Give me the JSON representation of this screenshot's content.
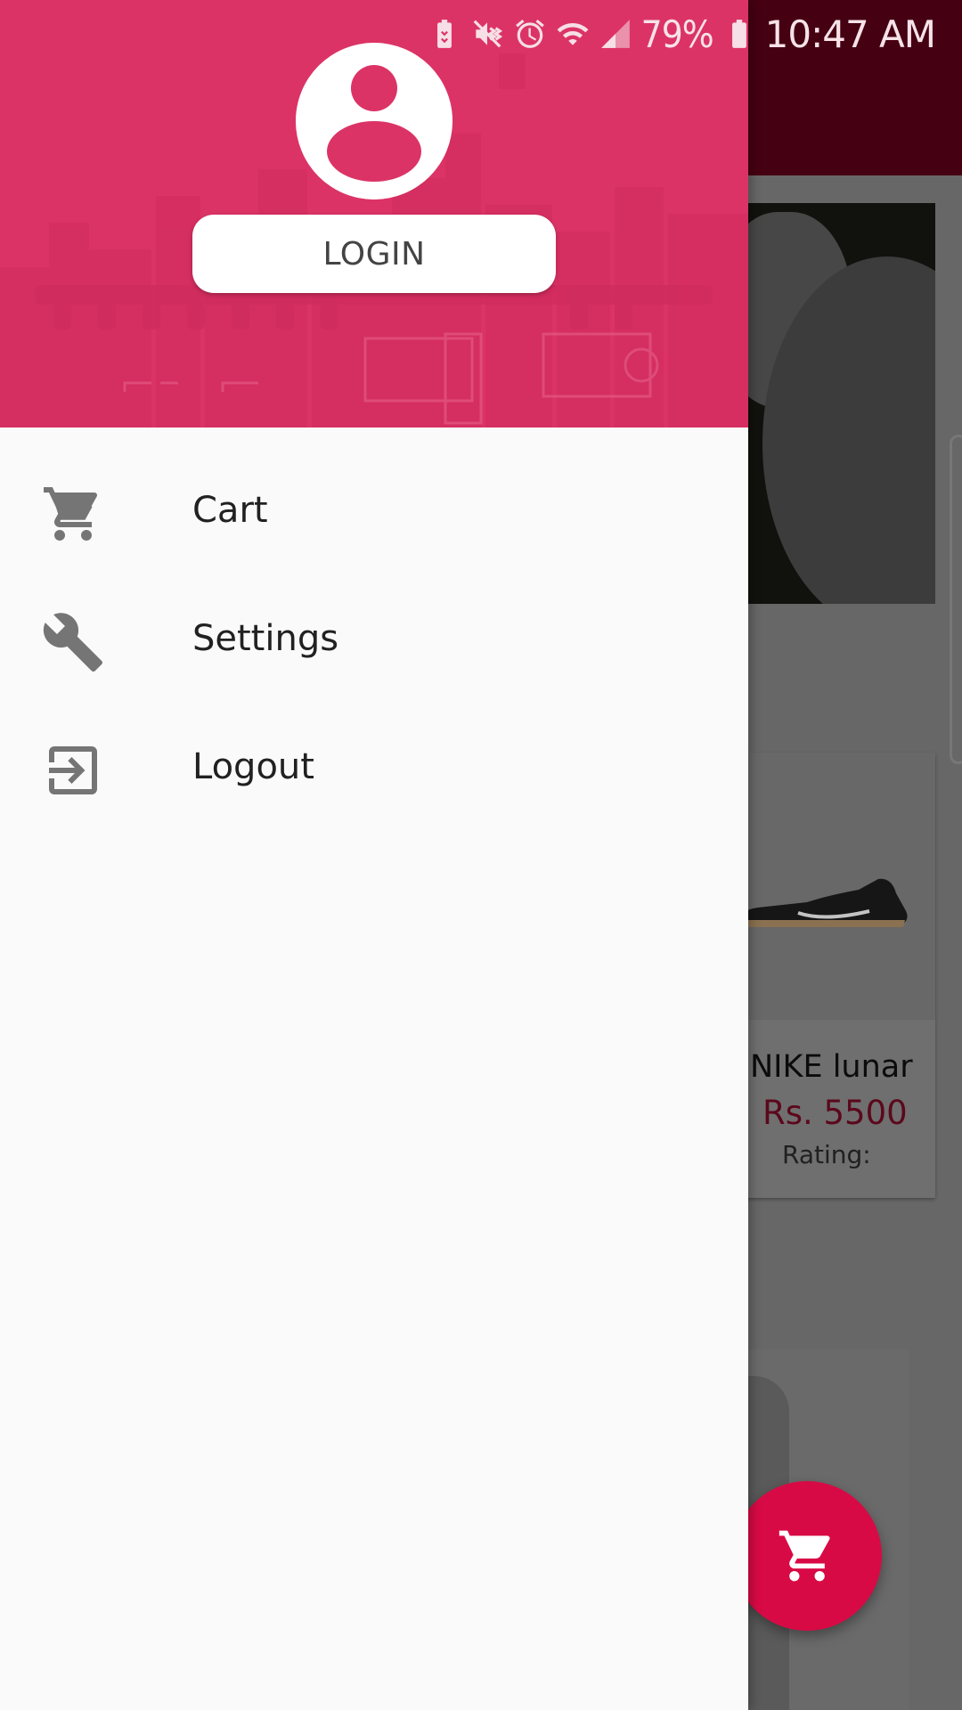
{
  "status_bar": {
    "battery_percent": "79%",
    "time": "10:47 AM",
    "icons": [
      "battery-saver-icon",
      "vibrate-icon",
      "alarm-icon",
      "wifi-icon",
      "cell-signal-icon",
      "battery-icon"
    ]
  },
  "drawer": {
    "avatar_icon": "user-avatar-icon",
    "login_label": "LOGIN",
    "header_color": "#dc3366",
    "menu": [
      {
        "label": "Cart",
        "icon": "cart-icon"
      },
      {
        "label": "Settings",
        "icon": "wrench-icon"
      },
      {
        "label": "Logout",
        "icon": "logout-icon"
      }
    ]
  },
  "background": {
    "product": {
      "title": "NIKE lunar",
      "price": "Rs. 5500",
      "rating_label": "Rating:"
    }
  },
  "fab": {
    "icon": "cart-icon",
    "color": "#d80a45"
  }
}
